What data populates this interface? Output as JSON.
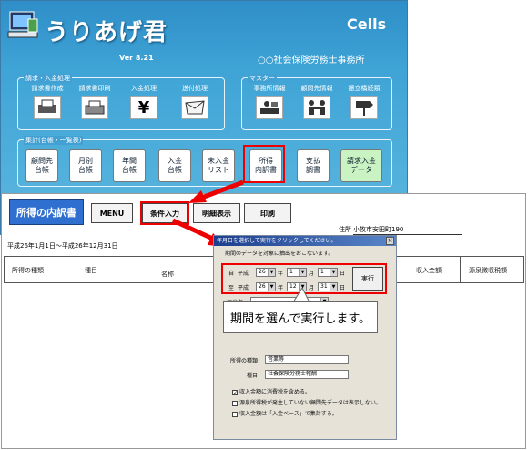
{
  "app": {
    "title": "うりあげ君",
    "brand": "Cells",
    "version": "Ver 8.21",
    "office": "○○社会保険労務士事務所",
    "billing_group": {
      "title": "請求・入金処理",
      "items": [
        {
          "label": "請求書作成",
          "icon": "invoice-printer-icon"
        },
        {
          "label": "請求書印刷",
          "icon": "printer-icon"
        },
        {
          "label": "入金処理",
          "icon": "yen-icon"
        },
        {
          "label": "送付処理",
          "icon": "envelope-icon"
        }
      ]
    },
    "master_group": {
      "title": "マスター",
      "items": [
        {
          "label": "事務所情報",
          "icon": "office-desk-icon"
        },
        {
          "label": "顧問先情報",
          "icon": "handshake-icon"
        },
        {
          "label": "振立橋続類",
          "icon": "signpost-icon"
        }
      ]
    },
    "ledger_group": {
      "title": "集計(台帳・一覧表)",
      "items": [
        {
          "label": "顧問先\n台帳"
        },
        {
          "label": "月別\n台帳"
        },
        {
          "label": "年間\n台帳"
        },
        {
          "label": "入金\n台帳"
        },
        {
          "label": "未入金\nリスト"
        },
        {
          "label": "所得\n内訳書"
        },
        {
          "label": "支払\n調書"
        },
        {
          "label": "請求入金\nデータ"
        }
      ]
    }
  },
  "report": {
    "title": "所得の内訳書",
    "toolbar": {
      "menu": "MENU",
      "conditions": "条件入力",
      "detail": "明細表示",
      "print": "印刷"
    },
    "address_label": "住所",
    "address_value": "小牧市安田町190",
    "period": "平成26年1月1日～平成26年12月31日",
    "columns": [
      "所得の種類",
      "種目",
      "名称",
      "収入金額",
      "源泉徴収税額"
    ]
  },
  "dialog": {
    "title": "年月日を選択して実行をクリックしてください。",
    "instruction": "期間のデータを対象に抽出をおこないます。",
    "from_label": "自",
    "to_label": "至",
    "era": "平成",
    "from": {
      "year": "26",
      "month": "1",
      "day": "1"
    },
    "to": {
      "year": "26",
      "month": "12",
      "day": "31"
    },
    "unit_year": "年",
    "unit_month": "月",
    "unit_day": "日",
    "run_button": "実行",
    "close": "×",
    "dropdown_label": "担当者",
    "income_type_label": "所得の種類",
    "income_type_value": "営業等",
    "category_label": "種目",
    "category_value": "社会保険労務士報酬",
    "checkboxes": [
      {
        "label": "収入金額に消費税を含める。",
        "checked": true
      },
      {
        "label": "源泉所得税が発生していない顧問先データは表示しない。",
        "checked": false
      },
      {
        "label": "収入金額は「入金ベース」で集計する。",
        "checked": false
      }
    ]
  },
  "callout": "期間を選んで実行します。"
}
